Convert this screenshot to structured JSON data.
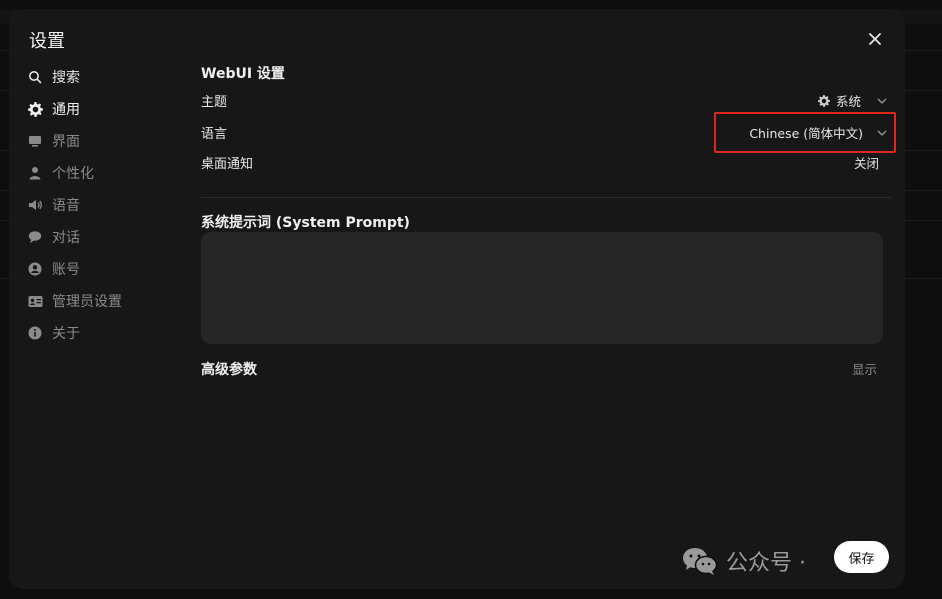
{
  "modal": {
    "title": "设置"
  },
  "sidebar": {
    "items": [
      {
        "label": "搜索",
        "icon": "search-icon"
      },
      {
        "label": "通用",
        "icon": "gear-icon",
        "active": true
      },
      {
        "label": "界面",
        "icon": "monitor-icon"
      },
      {
        "label": "个性化",
        "icon": "user-icon"
      },
      {
        "label": "语音",
        "icon": "speaker-icon"
      },
      {
        "label": "对话",
        "icon": "chat-icon"
      },
      {
        "label": "账号",
        "icon": "account-icon"
      },
      {
        "label": "管理员设置",
        "icon": "admin-card-icon"
      },
      {
        "label": "关于",
        "icon": "info-icon"
      }
    ]
  },
  "general": {
    "section_title": "WebUI 设置",
    "theme_label": "主题",
    "theme_value": "系统",
    "language_label": "语言",
    "language_value": "Chinese (简体中文)",
    "notify_label": "桌面通知",
    "notify_value": "关闭"
  },
  "prompt": {
    "title": "系统提示词 (System Prompt)",
    "value": ""
  },
  "advanced": {
    "title": "高级参数",
    "toggle_label": "显示"
  },
  "footer": {
    "save_label": "保存",
    "watermark_text": "公众号 · "
  },
  "colors": {
    "highlight": "#e0271d",
    "modal_bg": "#171717"
  }
}
